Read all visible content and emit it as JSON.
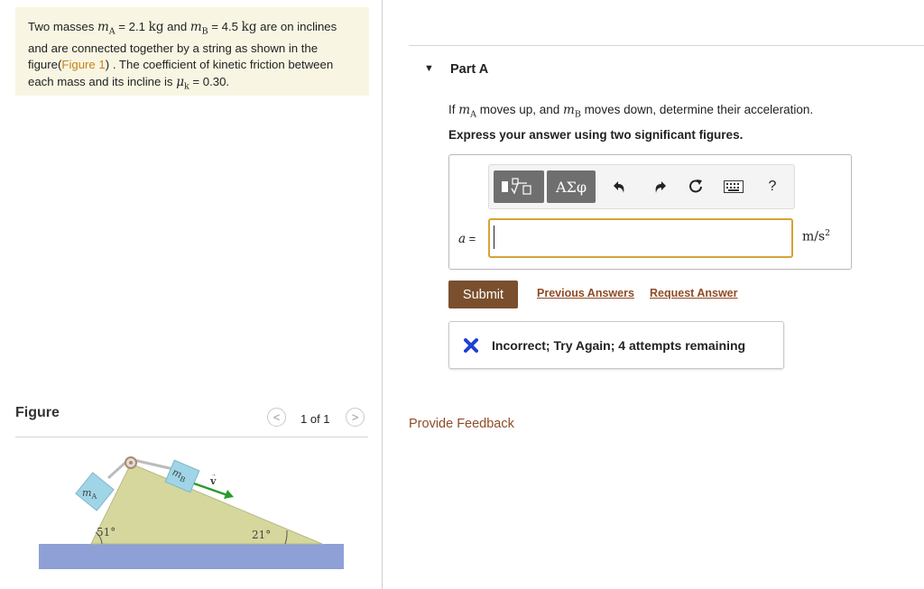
{
  "problem": {
    "t1": "Two masses ",
    "mA_eq": " = 2.1 ",
    "kg": "kg",
    "and": " and ",
    "mB_eq": " = 4.5 ",
    "t2": " are on inclines and are connected together by a string as shown in the figure(",
    "figure_link": "Figure 1",
    "t3": ") . The coefficient of kinetic friction between each mass and its incline is ",
    "mu_k": "μ",
    "mu_sub": "k",
    "mu_val": " = 0.30."
  },
  "figure_panel": {
    "title": "Figure",
    "prev_glyph": "<",
    "next_glyph": ">",
    "counter": "1 of 1"
  },
  "diagram": {
    "label_mA": "m",
    "label_mA_sub": "A",
    "label_mB": "m",
    "label_mB_sub": "B",
    "label_v": "v",
    "angle_left": "51°",
    "angle_right": "21°",
    "colors": {
      "incline": "#d6d79d",
      "ground": "#8ea0d6",
      "block": "#9fd5e6",
      "arrow": "#2a9b2a"
    }
  },
  "part_a": {
    "caret": "▼",
    "title": "Part A",
    "q_if": "If ",
    "q_m": "m",
    "q_A": "A",
    "q_mid": " moves up, and ",
    "q_B": "B",
    "q_end": " moves down, determine their acceleration.",
    "instruction": "Express your answer using two significant figures.",
    "toolbar": {
      "template_icon": "templates-icon",
      "greek_label": "ΑΣφ",
      "undo_icon": "undo-icon",
      "redo_icon": "redo-icon",
      "reset_icon": "reset-icon",
      "keyboard_icon": "keyboard-icon",
      "help_label": "?"
    },
    "answer_var": "a",
    "answer_eq": " =",
    "answer_value": "",
    "unit_base": "m/s",
    "unit_exp": "2",
    "submit_label": "Submit",
    "previous_answers_label": "Previous Answers",
    "request_answer_label": "Request Answer",
    "feedback": "Incorrect; Try Again; 4 attempts remaining",
    "feedback_icon": "x-icon"
  },
  "provide_feedback_label": "Provide Feedback"
}
